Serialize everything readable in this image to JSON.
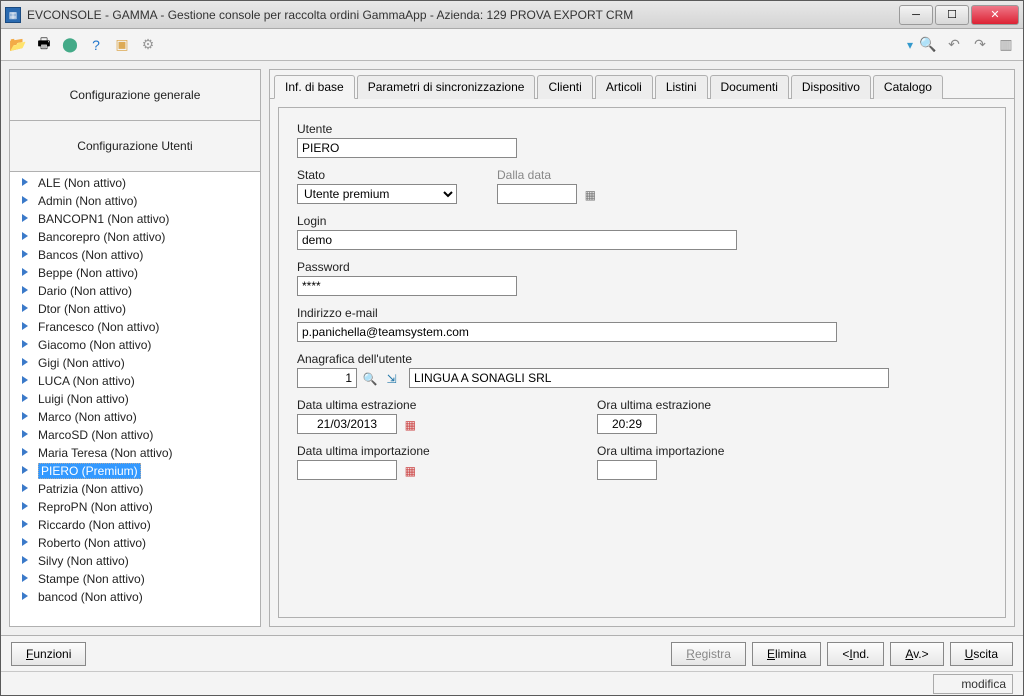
{
  "title": "EVCONSOLE - GAMMA - Gestione console per raccolta ordini GammaApp - Azienda:  129 PROVA EXPORT CRM",
  "sections": {
    "general": "Configurazione generale",
    "users": "Configurazione Utenti"
  },
  "tree": [
    "ALE (Non attivo)",
    "Admin (Non attivo)",
    "BANCOPN1 (Non attivo)",
    "Bancorepro (Non attivo)",
    "Bancos (Non attivo)",
    "Beppe (Non attivo)",
    "Dario (Non attivo)",
    "Dtor (Non attivo)",
    "Francesco (Non attivo)",
    "Giacomo (Non attivo)",
    "Gigi (Non attivo)",
    "LUCA (Non attivo)",
    "Luigi (Non attivo)",
    "Marco (Non attivo)",
    "MarcoSD (Non attivo)",
    "Maria Teresa (Non attivo)",
    "PIERO (Premium)",
    "Patrizia (Non attivo)",
    "ReproPN (Non attivo)",
    "Riccardo (Non attivo)",
    "Roberto (Non attivo)",
    "Silvy (Non attivo)",
    "Stampe (Non attivo)",
    "bancod (Non attivo)"
  ],
  "tree_selected_index": 16,
  "tabs": [
    "Inf. di base",
    "Parametri di sincronizzazione",
    "Clienti",
    "Articoli",
    "Listini",
    "Documenti",
    "Dispositivo",
    "Catalogo"
  ],
  "active_tab": 0,
  "form": {
    "utente_label": "Utente",
    "utente": "PIERO",
    "stato_label": "Stato",
    "stato": "Utente premium",
    "dalla_data_label": "Dalla data",
    "dalla_data": "",
    "login_label": "Login",
    "login": "demo",
    "password_label": "Password",
    "password": "****",
    "email_label": "Indirizzo e-mail",
    "email": "p.panichella@teamsystem.com",
    "anagrafica_label": "Anagrafica dell'utente",
    "anagrafica_code": "1",
    "anagrafica_name": "LINGUA A SONAGLI SRL",
    "data_estraz_label": "Data ultima estrazione",
    "data_estraz": "21/03/2013",
    "ora_estraz_label": "Ora ultima estrazione",
    "ora_estraz": "20:29",
    "data_import_label": "Data ultima importazione",
    "data_import": "",
    "ora_import_label": "Ora ultima importazione",
    "ora_import": ""
  },
  "buttons": {
    "funzioni": "Funzioni",
    "registra": "Registra",
    "elimina": "Elimina",
    "ind": "<Ind.",
    "av": "Av.>",
    "uscita": "Uscita"
  },
  "status": "modifica"
}
